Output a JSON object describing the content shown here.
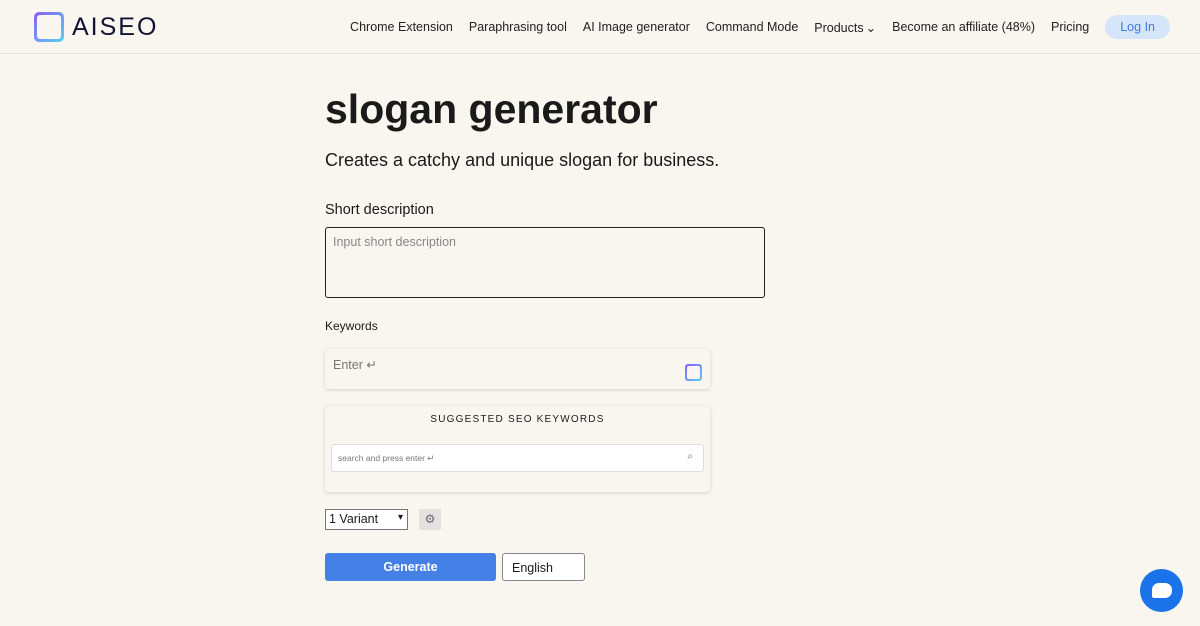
{
  "header": {
    "brand": "AISEO",
    "nav": [
      "Chrome Extension",
      "Paraphrasing tool",
      "AI Image generator",
      "Command Mode",
      "Products",
      "Become an affiliate (48%)",
      "Pricing"
    ],
    "login": "Log In"
  },
  "main": {
    "title": "slogan generator",
    "subtitle": "Creates a catchy and unique slogan for business.",
    "short_description": {
      "label": "Short description",
      "placeholder": "Input short description"
    },
    "keywords": {
      "label": "Keywords",
      "placeholder": "Enter ↵"
    },
    "seo": {
      "title": "SUGGESTED SEO KEYWORDS",
      "placeholder": "search and press enter ↵"
    },
    "variant": "1 Variant",
    "generate": "Generate",
    "language": "English"
  },
  "colors": {
    "accent": "#4580e6",
    "background": "#f9f6f0"
  }
}
